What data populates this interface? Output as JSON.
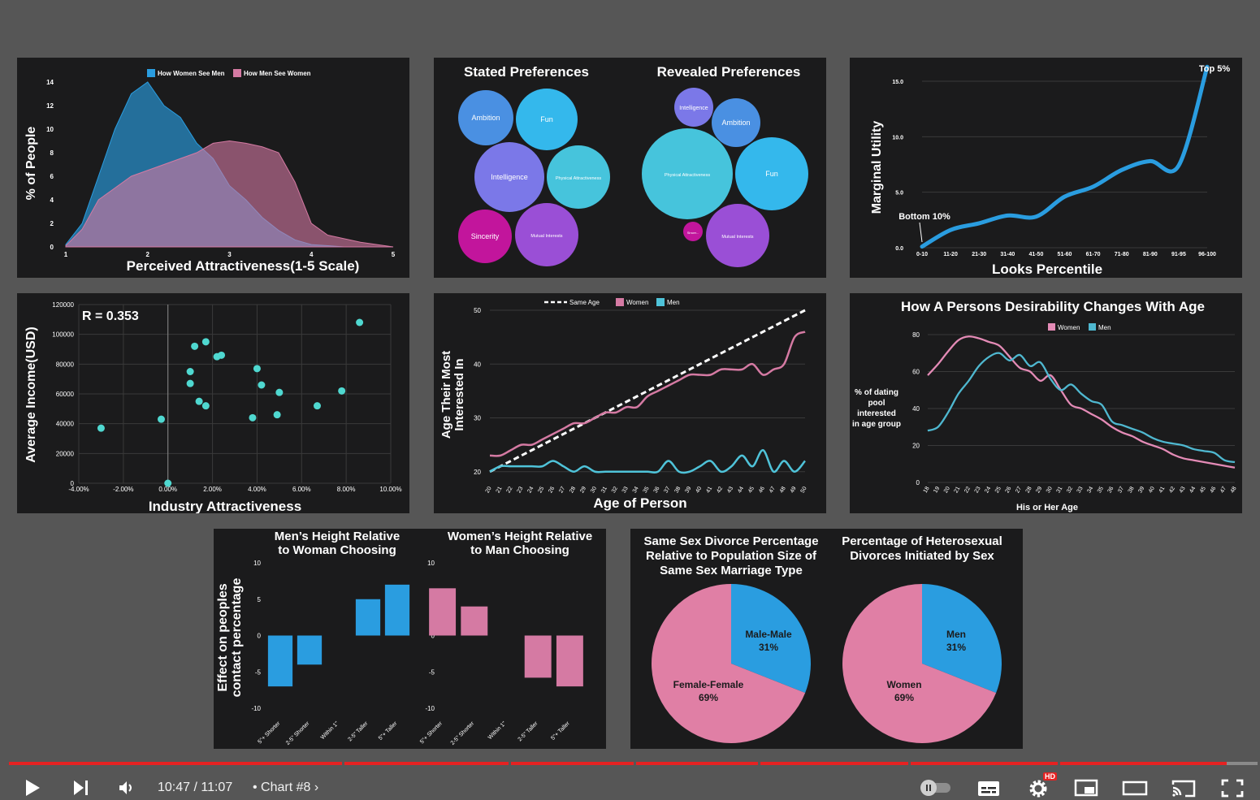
{
  "colors": {
    "blue": "#2a9de0",
    "pink": "#d57aa3",
    "teal": "#4fc3d9",
    "panel": "#1b1b1c",
    "progress": "#e52222"
  },
  "charts": {
    "attr": {
      "chart_data": {
        "type": "area",
        "title": "",
        "xlabel": "Perceived Attractiveness(1-5 Scale)",
        "ylabel": "% of People",
        "xlim": [
          1,
          5
        ],
        "ylim": [
          0,
          14
        ],
        "x_ticks": [
          "1",
          "2",
          "3",
          "4",
          "5"
        ],
        "y_ticks": [
          "0",
          "2",
          "4",
          "6",
          "8",
          "10",
          "12",
          "14"
        ],
        "x": [
          1,
          1.2,
          1.4,
          1.6,
          1.8,
          2.0,
          2.2,
          2.4,
          2.6,
          2.8,
          3.0,
          3.2,
          3.4,
          3.6,
          3.8,
          4.0,
          4.2,
          4.4,
          4.6,
          4.8,
          5.0
        ],
        "series": [
          {
            "name": "How Women See Men",
            "color": "#2a9de0",
            "values": [
              0.2,
              2.0,
              6.0,
              10.0,
              13.0,
              14.0,
              12.0,
              11.0,
              8.8,
              7.5,
              5.2,
              4.0,
              2.5,
              1.4,
              0.6,
              0.2,
              0.1,
              0,
              0,
              0,
              0
            ]
          },
          {
            "name": "How Men See Women",
            "color": "#d57aa3",
            "values": [
              0.1,
              1.5,
              4.0,
              5.0,
              6.0,
              6.5,
              7.0,
              7.5,
              8.0,
              8.8,
              9.0,
              8.8,
              8.5,
              8.0,
              5.5,
              2.0,
              1.0,
              0.7,
              0.4,
              0.2,
              0
            ]
          }
        ],
        "legend": "top-center"
      }
    },
    "prefs": {
      "chart_data": {
        "type": "bubble",
        "groups": [
          {
            "title": "Stated Preferences",
            "bubbles": [
              {
                "label": "Ambition",
                "color": "#4a90e2"
              },
              {
                "label": "Fun",
                "color": "#34b8ec"
              },
              {
                "label": "Intelligence",
                "color": "#7b78e8"
              },
              {
                "label": "Physical Attractiveness",
                "color": "#46c4dc"
              },
              {
                "label": "Sincerity",
                "color": "#c2159c"
              },
              {
                "label": "Mutual Interests",
                "color": "#9a4fd6"
              }
            ]
          },
          {
            "title": "Revealed Preferences",
            "bubbles": [
              {
                "label": "Intelligence",
                "color": "#7b78e8"
              },
              {
                "label": "Ambition",
                "color": "#4a90e2"
              },
              {
                "label": "Physical Attractiveness",
                "color": "#46c4dc"
              },
              {
                "label": "Fun",
                "color": "#34b8ec"
              },
              {
                "label": "Sincer...",
                "color": "#c2159c"
              },
              {
                "label": "Mutual Interests",
                "color": "#9a4fd6"
              }
            ]
          }
        ]
      }
    },
    "looks": {
      "chart_data": {
        "type": "line",
        "xlabel": "Looks Percentile",
        "ylabel": "Marginal Utility",
        "ylim": [
          0,
          15
        ],
        "y_ticks": [
          "0.0",
          "5.0",
          "10.0",
          "15.0"
        ],
        "categories": [
          "0-10",
          "11-20",
          "21-30",
          "31-40",
          "41-50",
          "51-60",
          "61-70",
          "71-80",
          "81-90",
          "91-95",
          "96-100"
        ],
        "values": [
          0.1,
          1.6,
          2.2,
          2.9,
          2.8,
          4.6,
          5.5,
          7.0,
          7.8,
          7.4,
          16.3
        ],
        "color": "#2a9de0",
        "annotations": [
          {
            "text": "Bottom 10%"
          },
          {
            "text": "Top 5%"
          }
        ]
      }
    },
    "income": {
      "chart_data": {
        "type": "scatter",
        "xlabel": "Industry Attractiveness",
        "ylabel": "Average Income(USD)",
        "annotation": "R = 0.353",
        "xlim": [
          -0.04,
          0.1
        ],
        "ylim": [
          0,
          120000
        ],
        "x_ticks": [
          "-4.00%",
          "-2.00%",
          "0.00%",
          "2.00%",
          "4.00%",
          "6.00%",
          "8.00%",
          "10.00%"
        ],
        "y_ticks": [
          "0",
          "20000",
          "40000",
          "60000",
          "80000",
          "100000",
          "120000"
        ],
        "x": [
          -0.03,
          -0.003,
          0.0,
          0.01,
          0.01,
          0.012,
          0.014,
          0.017,
          0.017,
          0.022,
          0.024,
          0.038,
          0.04,
          0.042,
          0.049,
          0.05,
          0.067,
          0.078,
          0.086
        ],
        "y": [
          37000,
          43000,
          0,
          75000,
          67000,
          92000,
          55000,
          95000,
          52000,
          85000,
          86000,
          44000,
          77000,
          66000,
          46000,
          61000,
          52000,
          62000,
          108000
        ],
        "color": "#4fd8d0"
      }
    },
    "agepref": {
      "chart_data": {
        "type": "line",
        "xlabel": "Age of Person",
        "ylabel": "Age Their Most Interested In",
        "ylim": [
          18,
          50
        ],
        "y_ticks": [
          "20",
          "30",
          "40",
          "50"
        ],
        "x_min": 20,
        "x_max": 50,
        "series": [
          {
            "name": "Same Age",
            "color": "#ffffff",
            "style": "dashed",
            "values": [
              20,
              21,
              22,
              23,
              24,
              25,
              26,
              27,
              28,
              29,
              30,
              31,
              32,
              33,
              34,
              35,
              36,
              37,
              38,
              39,
              40,
              41,
              42,
              43,
              44,
              45,
              46,
              47,
              48,
              49,
              50
            ]
          },
          {
            "name": "Women",
            "color": "#d57aa3",
            "values": [
              23,
              23,
              24,
              25,
              25,
              26,
              27,
              28,
              29,
              29,
              30,
              31,
              31,
              32,
              32,
              34,
              35,
              36,
              37,
              38,
              38,
              38,
              39,
              39,
              39,
              40,
              38,
              39,
              40,
              45,
              46
            ]
          },
          {
            "name": "Men",
            "color": "#4fc3d9",
            "values": [
              20,
              21,
              21,
              21,
              21,
              21,
              22,
              21,
              20,
              21,
              20,
              20,
              20,
              20,
              20,
              20,
              20,
              22,
              20,
              20,
              21,
              22,
              20,
              21,
              23,
              21,
              24,
              20,
              22,
              20,
              22
            ]
          }
        ],
        "legend": "top-center"
      }
    },
    "desire": {
      "chart_data": {
        "type": "line",
        "title": "How A Persons Desirability Changes With Age",
        "xlabel": "His or Her Age",
        "ylabel": "% of dating pool interested in age group",
        "ylim": [
          0,
          80
        ],
        "y_ticks": [
          "0",
          "20",
          "40",
          "60",
          "80"
        ],
        "x_min": 18,
        "x_max": 48,
        "series": [
          {
            "name": "Women",
            "color": "#e48bb6",
            "values": [
              58,
              64,
              71,
              77,
              79,
              78,
              76,
              74,
              68,
              62,
              60,
              55,
              58,
              50,
              42,
              40,
              37,
              34,
              30,
              27,
              25,
              22,
              20,
              18,
              15,
              13,
              12,
              11,
              10,
              9,
              8
            ]
          },
          {
            "name": "Men",
            "color": "#4fb8d0",
            "values": [
              28,
              30,
              38,
              48,
              55,
              63,
              68,
              70,
              66,
              69,
              63,
              65,
              56,
              50,
              53,
              48,
              44,
              42,
              33,
              31,
              29,
              27,
              24,
              22,
              21,
              20,
              18,
              17,
              16,
              12,
              11
            ]
          }
        ],
        "legend": "top-center"
      }
    },
    "height": {
      "chart_data": [
        {
          "type": "bar",
          "title": "Men’s Height Relative to Woman Choosing",
          "ylabel": "Effect on peoples contact percentage",
          "ylim": [
            -10,
            10
          ],
          "y_ticks": [
            "10",
            "5",
            "0",
            "-5",
            "-10"
          ],
          "categories": [
            "5\"+ Shorter",
            "2-5\" Shorter",
            "Within 1\"",
            "2-5\" Taller",
            "5\"+ Taller"
          ],
          "values": [
            -7,
            -4,
            0,
            5,
            7
          ],
          "color": "#2a9de0"
        },
        {
          "type": "bar",
          "title": "Women’s Height Relative to Man Choosing",
          "ylim": [
            -10,
            10
          ],
          "y_ticks": [
            "10",
            "5",
            "0",
            "-5",
            "-10"
          ],
          "categories": [
            "5\"+ Shorter",
            "2-5\" Shorter",
            "Within 1\"",
            "2-5\" Taller",
            "5\"+ Taller"
          ],
          "values": [
            6.5,
            4,
            0,
            -5.8,
            -7
          ],
          "color": "#d57aa3"
        }
      ]
    },
    "divorce": {
      "chart_data": [
        {
          "type": "pie",
          "title": "Same Sex Divorce Percentage Relative to Population Size of Same Sex Marriage Type",
          "slices": [
            {
              "label": "Male-Male",
              "value": 31,
              "display": "31%",
              "color": "#2a9de0"
            },
            {
              "label": "Female-Female",
              "value": 69,
              "display": "69%",
              "color": "#e07fa5"
            }
          ]
        },
        {
          "type": "pie",
          "title": "Percentage of Heterosexual Divorces Initiated by Sex",
          "slices": [
            {
              "label": "Men",
              "value": 31,
              "display": "31%",
              "color": "#2a9de0"
            },
            {
              "label": "Women",
              "value": 69,
              "display": "69%",
              "color": "#e07fa5"
            }
          ]
        }
      ]
    }
  },
  "player": {
    "time": "10:47 / 11:07",
    "chapter": "Chart #8",
    "progress": 0.975,
    "chapter_marks": [
      0.267,
      0.4,
      0.5,
      0.6,
      0.72,
      0.84
    ],
    "hd_badge": "HD"
  }
}
